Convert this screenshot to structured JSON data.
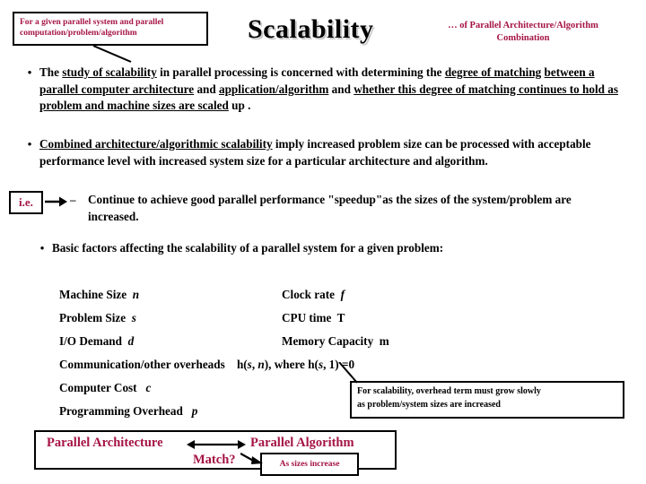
{
  "header": {
    "callout_line1": "For a given parallel system and parallel",
    "callout_line2": "computation/problem/algorithm",
    "title": "Scalability",
    "subtitle_line1": "… of  Parallel Architecture/Algorithm",
    "subtitle_line2": "Combination"
  },
  "bullets": {
    "marker": "•",
    "b1": {
      "p1": "The ",
      "u1": "study of scalability",
      "p2": " in parallel processing is concerned with determining the ",
      "u2": "degree of matching",
      "p3": " ",
      "u3": "between a parallel computer architecture",
      "p4": " and ",
      "u4": "application/algorithm",
      "p5": " and ",
      "u5": "whether this degree of matching continues to hold as problem and machine sizes are scaled",
      "p6": " up ."
    },
    "b2": {
      "u1": "Combined architecture/algorithmic scalability",
      "p1": " imply  increased problem size can be processed with acceptable performance level with increased system size for a particular architecture and algorithm."
    },
    "b3": "Basic factors affecting the scalability of a parallel system  for a given problem:"
  },
  "ie": {
    "label": "i.e.",
    "dash": "–",
    "text": "Continue to achieve good parallel performance \"speedup\"as the sizes of the system/problem are increased."
  },
  "factors": {
    "rows": [
      {
        "left_label": "Machine Size",
        "left_var": "n",
        "right_label": "Clock rate",
        "right_var": "f",
        "right_var_italic": true
      },
      {
        "left_label": "Problem Size",
        "left_var": "s",
        "right_label": "CPU time",
        "right_var": "T",
        "right_var_italic": false
      },
      {
        "left_label": "I/O Demand",
        "left_var": "d",
        "right_label": "Memory Capacity",
        "right_var": "m",
        "right_var_italic": false
      }
    ],
    "overheads_label": "Communication/other overheads",
    "overheads_expr_a": "h(",
    "overheads_expr_s": "s",
    "overheads_expr_b": ", ",
    "overheads_expr_n": "n",
    "overheads_expr_c": "),   where  h(",
    "overheads_expr_s2": "s",
    "overheads_expr_d": ", 1) =0",
    "cost_label": "Computer Cost",
    "cost_var": "c",
    "prog_label": "Programming Overhead",
    "prog_var": "p"
  },
  "overhead_callout": {
    "line1": "For scalability, overhead term must grow slowly",
    "line2": "as  problem/system sizes are increased"
  },
  "match": {
    "left": "Parallel Architecture",
    "right": "Parallel Algorithm",
    "question": "Match?",
    "sizes_note": "As sizes increase"
  },
  "colors": {
    "accent_red": "#A51444",
    "text_black": "#000000",
    "background": "#FFFFFF"
  }
}
